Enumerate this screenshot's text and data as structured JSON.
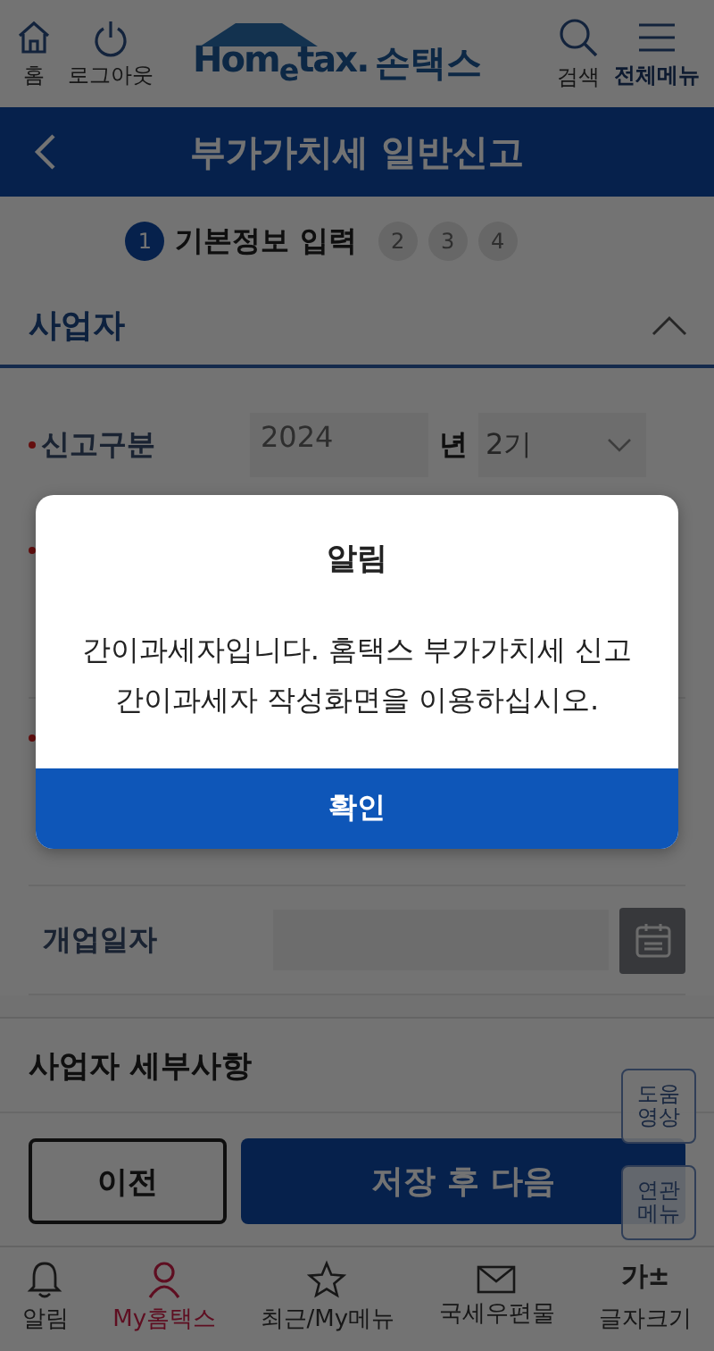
{
  "header": {
    "home_label": "홈",
    "logout_label": "로그아웃",
    "logo_latin": "Hom$_{e}$tax.",
    "logo_korean": "손택스",
    "search_label": "검색",
    "menu_label": "전체메뉴"
  },
  "title_bar": {
    "title": "부가가치세 일반신고"
  },
  "steps": [
    {
      "number": "1",
      "label": "기본정보 입력",
      "selected": true
    },
    {
      "number": "2",
      "selected": false
    },
    {
      "number": "3",
      "selected": false
    },
    {
      "number": "4",
      "selected": false
    }
  ],
  "section": {
    "title": "사업자",
    "expanded": true
  },
  "fields": [
    {
      "kind": "period",
      "label": "신고구분",
      "required": true,
      "year": "2024",
      "year_unit": "년",
      "term": "2기"
    },
    {
      "kind": "hidden",
      "required": true
    },
    {
      "kind": "hidden",
      "required": true
    },
    {
      "kind": "date",
      "label": "개업일자",
      "required": false
    }
  ],
  "subsection": {
    "title": "사업자 세부사항"
  },
  "float_buttons": [
    {
      "lines": [
        "도움",
        "영상"
      ]
    },
    {
      "lines": [
        "연관",
        "메뉴"
      ]
    }
  ],
  "actions": {
    "prev": "이전",
    "next": "저장 후 다음"
  },
  "tabbar": [
    {
      "kind": "bell",
      "label": "알림",
      "selected": false
    },
    {
      "kind": "person",
      "label": "My홈택스",
      "selected": true
    },
    {
      "kind": "star",
      "label": "최근/My메뉴",
      "selected": false
    },
    {
      "kind": "mail",
      "label": "국세우편물",
      "selected": false
    },
    {
      "kind": "font",
      "glyph": "가±",
      "label": "글자크기",
      "selected": false
    }
  ],
  "dialog": {
    "title": "알림",
    "message": "간이과세자입니다. 홈택스 부가가치세 신고 간이과세자 작성화면을 이용하십시오.",
    "confirm": "확인"
  }
}
